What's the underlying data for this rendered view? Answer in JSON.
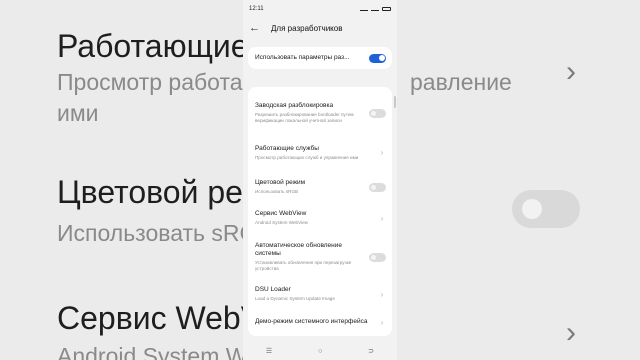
{
  "status_bar": {
    "time": "12:11",
    "icons_text": "ᐧ ⓘ ▾ ✉ ▭"
  },
  "header": {
    "title": "Для разработчиков"
  },
  "top_setting": {
    "label": "Использовать параметры раз...",
    "enabled": true
  },
  "settings": [
    {
      "title": "Заводская разблокировка",
      "subtitle": "Разрешить разблокирование bootloader путем верификации локальной учетной записи",
      "control": "toggle",
      "enabled": false
    },
    {
      "title": "Работающие службы",
      "subtitle": "Просмотр работающих служб и управление ими",
      "control": "chevron"
    },
    {
      "title": "Цветовой режим",
      "subtitle": "Использовать sRGB",
      "control": "toggle",
      "enabled": false
    },
    {
      "title": "Сервис WebView",
      "subtitle": "Android System WebView",
      "control": "chevron"
    },
    {
      "title": "Автоматическое обновление системы",
      "subtitle": "Устанавливать обновления при перезагрузке устройства",
      "control": "toggle",
      "enabled": false
    },
    {
      "title": "DSU Loader",
      "subtitle": "Load a Dynamic System Update Image",
      "control": "chevron"
    },
    {
      "title": "Демо-режим системного интерфейса",
      "subtitle": "",
      "control": "chevron"
    }
  ],
  "background": {
    "title1": "Работающие с",
    "sub1a": "Просмотр работающ",
    "sub1b": "равление",
    "sub1c": "ими",
    "title2": "Цветовой реж",
    "sub2": "Использовать sRG",
    "title3": "Сервис WebVi",
    "sub3": "Android System We"
  },
  "navbar": {
    "menu": "☰",
    "home": "○",
    "back": "⊃"
  }
}
